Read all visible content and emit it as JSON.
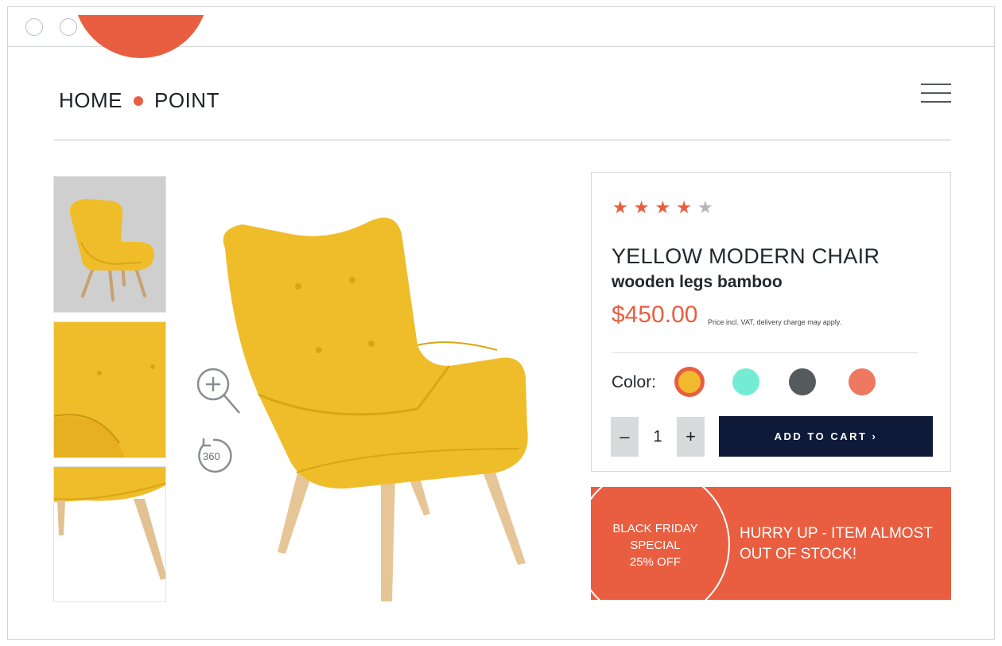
{
  "header": {
    "logo_left": "HOME",
    "logo_right": "POINT"
  },
  "gallery": {
    "thumbnails": [
      "chair-full-view",
      "chair-back-detail",
      "chair-leg-detail"
    ],
    "tools": {
      "zoom": "zoom-in-icon",
      "rotate_label": "360"
    }
  },
  "product": {
    "rating": 4,
    "rating_max": 5,
    "title": "YELLOW MODERN CHAIR",
    "subtitle": "wooden legs bamboo",
    "price": "$450.00",
    "price_note": "Price incl. VAT, delivery charge may apply.",
    "color_label": "Color:",
    "colors": [
      "#f0b92e",
      "#74ecd3",
      "#555a5d",
      "#ee7860"
    ],
    "selected_color": 0,
    "quantity": "1",
    "qty_minus": "–",
    "qty_plus": "+",
    "add_to_cart": "ADD TO CART ›"
  },
  "promo": {
    "line1": "BLACK FRIDAY",
    "line2": "SPECIAL",
    "line3": "25% OFF",
    "message": "HURRY UP - ITEM ALMOST OUT OF STOCK!"
  },
  "colors": {
    "accent": "#e95e41",
    "star_filled": "#e95e41",
    "star_empty": "#b4b7ba",
    "cart_button": "#0f1a38",
    "thumb_bg": "#cfcfcf",
    "chair_yellow": "#efbd2a"
  }
}
